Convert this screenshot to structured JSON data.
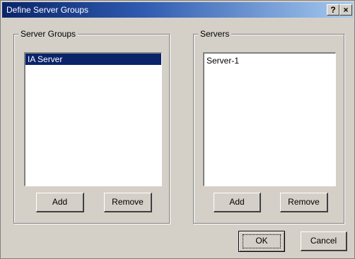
{
  "window": {
    "title": "Define Server Groups",
    "help_label": "?",
    "close_label": "×"
  },
  "server_groups": {
    "legend": "Server Groups",
    "items": [
      "IA Server"
    ],
    "selected_index": 0,
    "add_label": "Add",
    "remove_label": "Remove"
  },
  "servers": {
    "legend": "Servers",
    "items": [
      "Server-1"
    ],
    "add_label": "Add",
    "remove_label": "Remove"
  },
  "footer": {
    "ok_label": "OK",
    "cancel_label": "Cancel"
  },
  "colors": {
    "titlebar_start": "#0a246a",
    "titlebar_end": "#a6caf0",
    "selection": "#0a246a",
    "dialog_face": "#d4d0c8"
  }
}
